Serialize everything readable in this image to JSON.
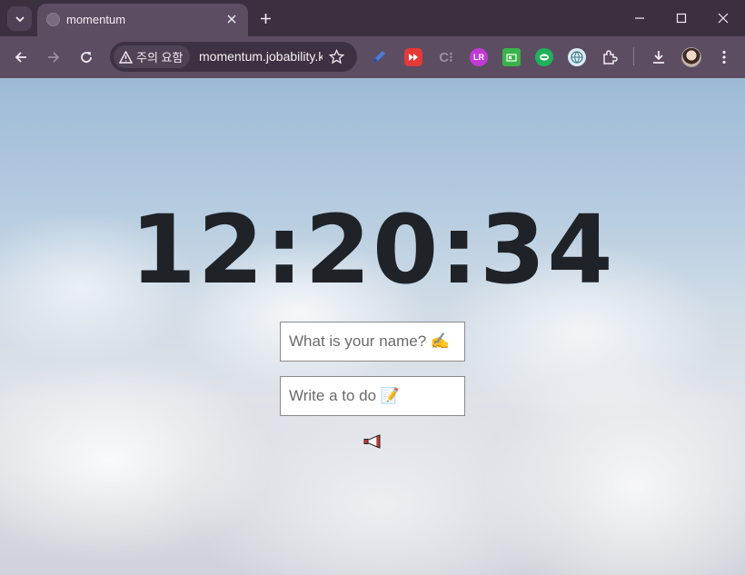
{
  "browser": {
    "tab": {
      "title": "momentum"
    },
    "omnibox": {
      "security_label": "주의 요함",
      "url": "momentum.jobability.kr"
    }
  },
  "clock": {
    "time": "12:20:34"
  },
  "greeting_form": {
    "placeholder": "What is your name? ✍️"
  },
  "todo_form": {
    "placeholder": "Write a to do 📝"
  },
  "colors": {
    "clock_text": "#1f2328",
    "frame": "#5c4d63",
    "titlebar": "#3b3040"
  },
  "icons": [
    "tab-search-icon",
    "close-icon",
    "plus-icon",
    "minimize-icon",
    "maximize-icon",
    "back-icon",
    "forward-icon",
    "reload-icon",
    "warning-icon",
    "star-icon",
    "extensions-icon",
    "download-icon",
    "more-icon",
    "megaphone-icon"
  ]
}
